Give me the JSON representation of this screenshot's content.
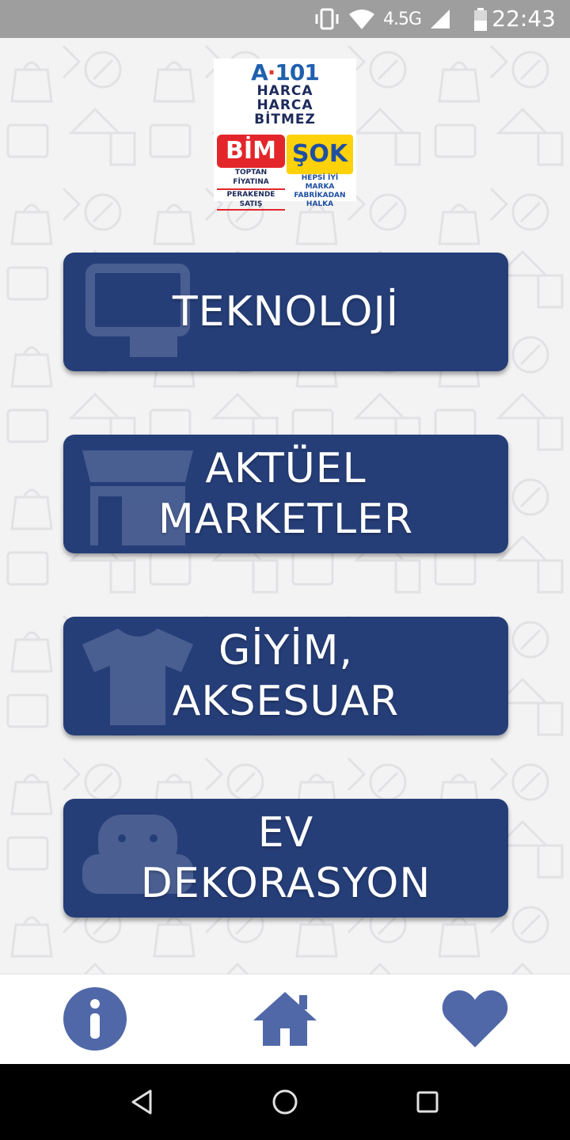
{
  "status_bar": {
    "network": "4.5G",
    "time": "22:43",
    "icons": [
      "vibrate-icon",
      "wifi-icon",
      "signal-icon",
      "battery-icon"
    ]
  },
  "logo": {
    "a101_brand_left": "A",
    "a101_brand_dot": "·",
    "a101_brand_right": "101",
    "a101_slogan": [
      "HARCA",
      "HARCA",
      "BİTMEZ"
    ],
    "bim_brand": "BİM",
    "bim_line1": "TOPTAN FİYATINA",
    "bim_line2": "PERAKENDE SATIŞ",
    "sok_brand": "ŞOK",
    "sok_line1": "HEPSİ İYİ MARKA",
    "sok_line2": "FABRİKADAN HALKA"
  },
  "categories": [
    {
      "line1": "TEKNOLOJİ",
      "line2": "",
      "icon": "laptop-icon"
    },
    {
      "line1": "AKTÜEL",
      "line2": "MARKETLER",
      "icon": "store-icon"
    },
    {
      "line1": "GİYİM,",
      "line2": "AKSESUAR",
      "icon": "tshirt-icon"
    },
    {
      "line1": "EV",
      "line2": "DEKORASYON",
      "icon": "armchair-icon"
    }
  ],
  "bottom_nav": {
    "items": [
      "info-icon",
      "home-icon",
      "heart-icon"
    ],
    "accent": "#5068a8"
  },
  "colors": {
    "button": "#263e78",
    "status_bar": "#9e9e9e",
    "background": "#f3f3f4"
  }
}
